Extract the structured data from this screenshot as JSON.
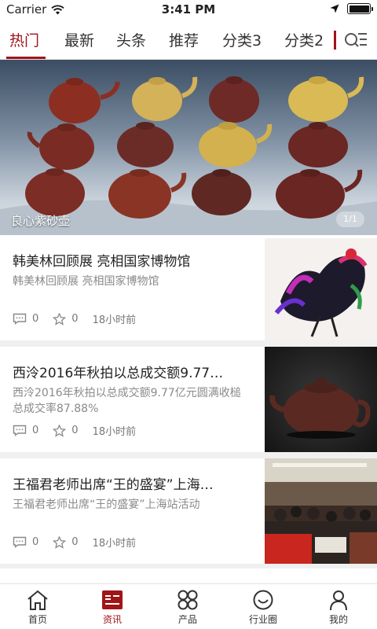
{
  "status_bar": {
    "carrier": "Carrier",
    "time": "3:41 PM"
  },
  "tabs": [
    {
      "label": "热门",
      "active": true
    },
    {
      "label": "最新",
      "active": false
    },
    {
      "label": "头条",
      "active": false
    },
    {
      "label": "推荐",
      "active": false
    },
    {
      "label": "分类3",
      "active": false
    },
    {
      "label": "分类2",
      "active": false
    }
  ],
  "banner": {
    "caption": "良心紫砂壶",
    "indicator": "1/1"
  },
  "news": [
    {
      "title": "韩美林回顾展 亮相国家博物馆",
      "summary": "韩美林回顾展 亮相国家博物馆",
      "comments": "0",
      "likes": "0",
      "time": "18小时前"
    },
    {
      "title": "西泠2016年秋拍以总成交额9.77…",
      "summary": "西泠2016年秋拍以总成交额9.77亿元圆满收槌 总成交率87.88%",
      "comments": "0",
      "likes": "0",
      "time": "18小时前"
    },
    {
      "title": "王福君老师出席“王的盛宴”上海…",
      "summary": "王福君老师出席“王的盛宴”上海站活动",
      "comments": "0",
      "likes": "0",
      "time": "18小时前"
    }
  ],
  "bottom_nav": [
    {
      "label": "首页",
      "icon": "home-icon",
      "active": false
    },
    {
      "label": "资讯",
      "icon": "news-icon",
      "active": true
    },
    {
      "label": "产品",
      "icon": "grid-icon",
      "active": false
    },
    {
      "label": "行业圈",
      "icon": "smile-circle-icon",
      "active": false
    },
    {
      "label": "我的",
      "icon": "person-icon",
      "active": false
    }
  ],
  "colors": {
    "accent": "#a01518",
    "separator": "#f0f0f0",
    "meta_text": "#777777"
  }
}
